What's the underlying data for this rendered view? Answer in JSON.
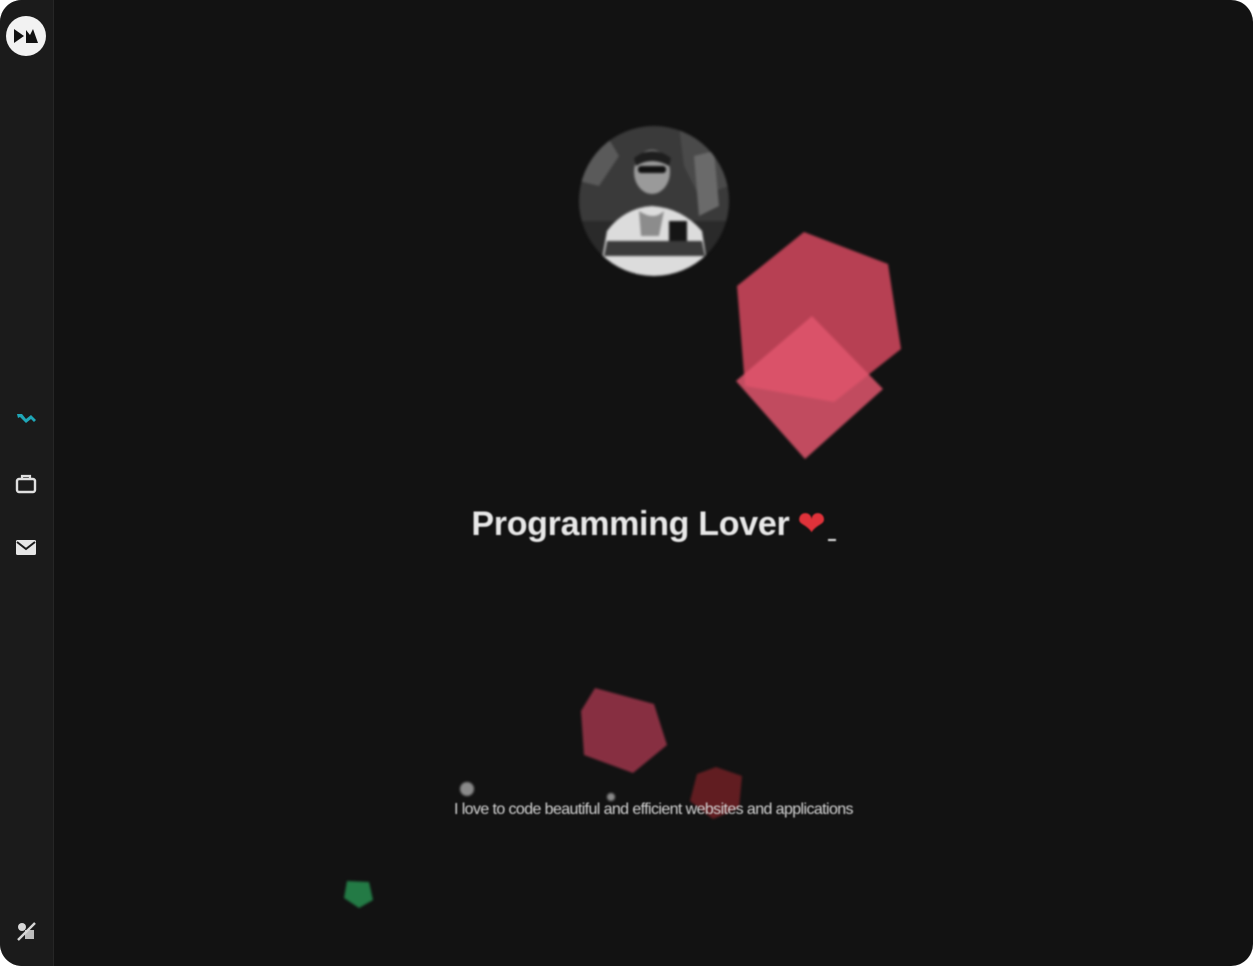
{
  "hero": {
    "headline": "Programming Lover",
    "headline_emoji": "heart-emoji",
    "tagline": "I love to code beautiful and efficient websites and applications"
  },
  "sidebar": {
    "logo": "logo-icon",
    "items": [
      {
        "icon": "home-icon",
        "active": true
      },
      {
        "icon": "briefcase-icon",
        "active": false
      },
      {
        "icon": "mail-icon",
        "active": false
      }
    ],
    "footer_icon": "theme-toggle-icon"
  },
  "colors": {
    "background": "#121212",
    "sidebar": "#1b1b1b",
    "accent": "#1fa7b8",
    "shape_red": "#c64459",
    "shape_dark_red": "#8e3144",
    "shape_maroon": "#6a1f24",
    "shape_green": "#237a45"
  }
}
